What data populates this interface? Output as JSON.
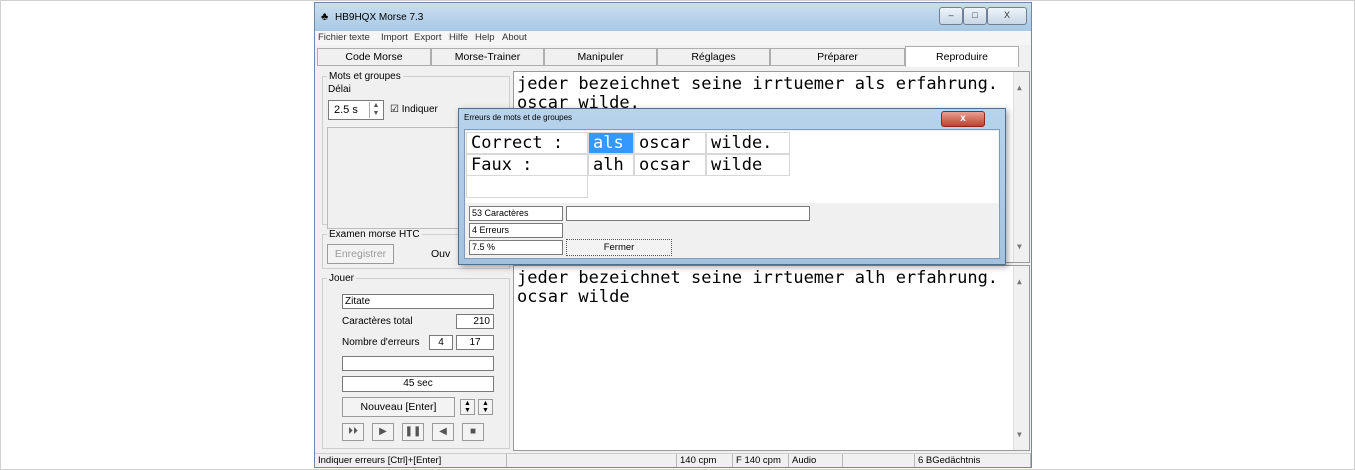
{
  "window": {
    "title": "HB9HQX Morse 7.3",
    "controls": {
      "minimize": "–",
      "maximize": "□",
      "close": "X"
    }
  },
  "menu": [
    "Fichier texte",
    "Import",
    "Export",
    "Hilfe",
    "Help",
    "About"
  ],
  "tabs": [
    {
      "label": "Code Morse",
      "active": false
    },
    {
      "label": "Morse-Trainer",
      "active": false
    },
    {
      "label": "Manipuler",
      "active": false
    },
    {
      "label": "Réglages",
      "active": false
    },
    {
      "label": "Préparer",
      "active": false
    },
    {
      "label": "Reproduire",
      "active": true
    }
  ],
  "left": {
    "words_group": {
      "title": "Mots et groupes",
      "delay_label": "Délai",
      "delay_value": "2.5 s",
      "indicate_label": "Indiquer",
      "indicate_checked": true
    },
    "exam_group": {
      "title": "Examen morse HTC",
      "record_button": "Enregistrer",
      "open_button": "Ouv"
    },
    "play_group": {
      "title": "Jouer",
      "source_value": "Zitate",
      "total_chars_label": "Caractères total",
      "total_chars_value": "210",
      "errors_label": "Nombre d'erreurs",
      "errors_value": "4",
      "errors_value2": "17",
      "time_value": "45 sec",
      "new_button": "Nouveau  [Enter]"
    }
  },
  "text_top": [
    "jeder bezeichnet seine irrtuemer als erfahrung.",
    "oscar wilde."
  ],
  "text_bottom": [
    "jeder bezeichnet seine irrtuemer alh erfahrung.",
    "ocsar wilde"
  ],
  "dialog": {
    "title": "Erreurs de mots et de groupes",
    "close": "x",
    "row_correct": {
      "label": "Correct :",
      "words": [
        "als",
        "oscar",
        "wilde."
      ]
    },
    "row_wrong": {
      "label": "Faux    :",
      "words": [
        "alh",
        "ocsar",
        "wilde"
      ]
    },
    "chars": "53 Caractères",
    "errors": "4 Erreurs",
    "percent": "7.5 %",
    "close_button": "Fermer"
  },
  "statusbar": {
    "hint": "Indiquer erreurs  [Ctrl]+[Enter]",
    "cpm": "140 cpm",
    "fcpm": "F 140 cpm",
    "audio": "Audio",
    "memory": "6 BGedächtnis"
  }
}
